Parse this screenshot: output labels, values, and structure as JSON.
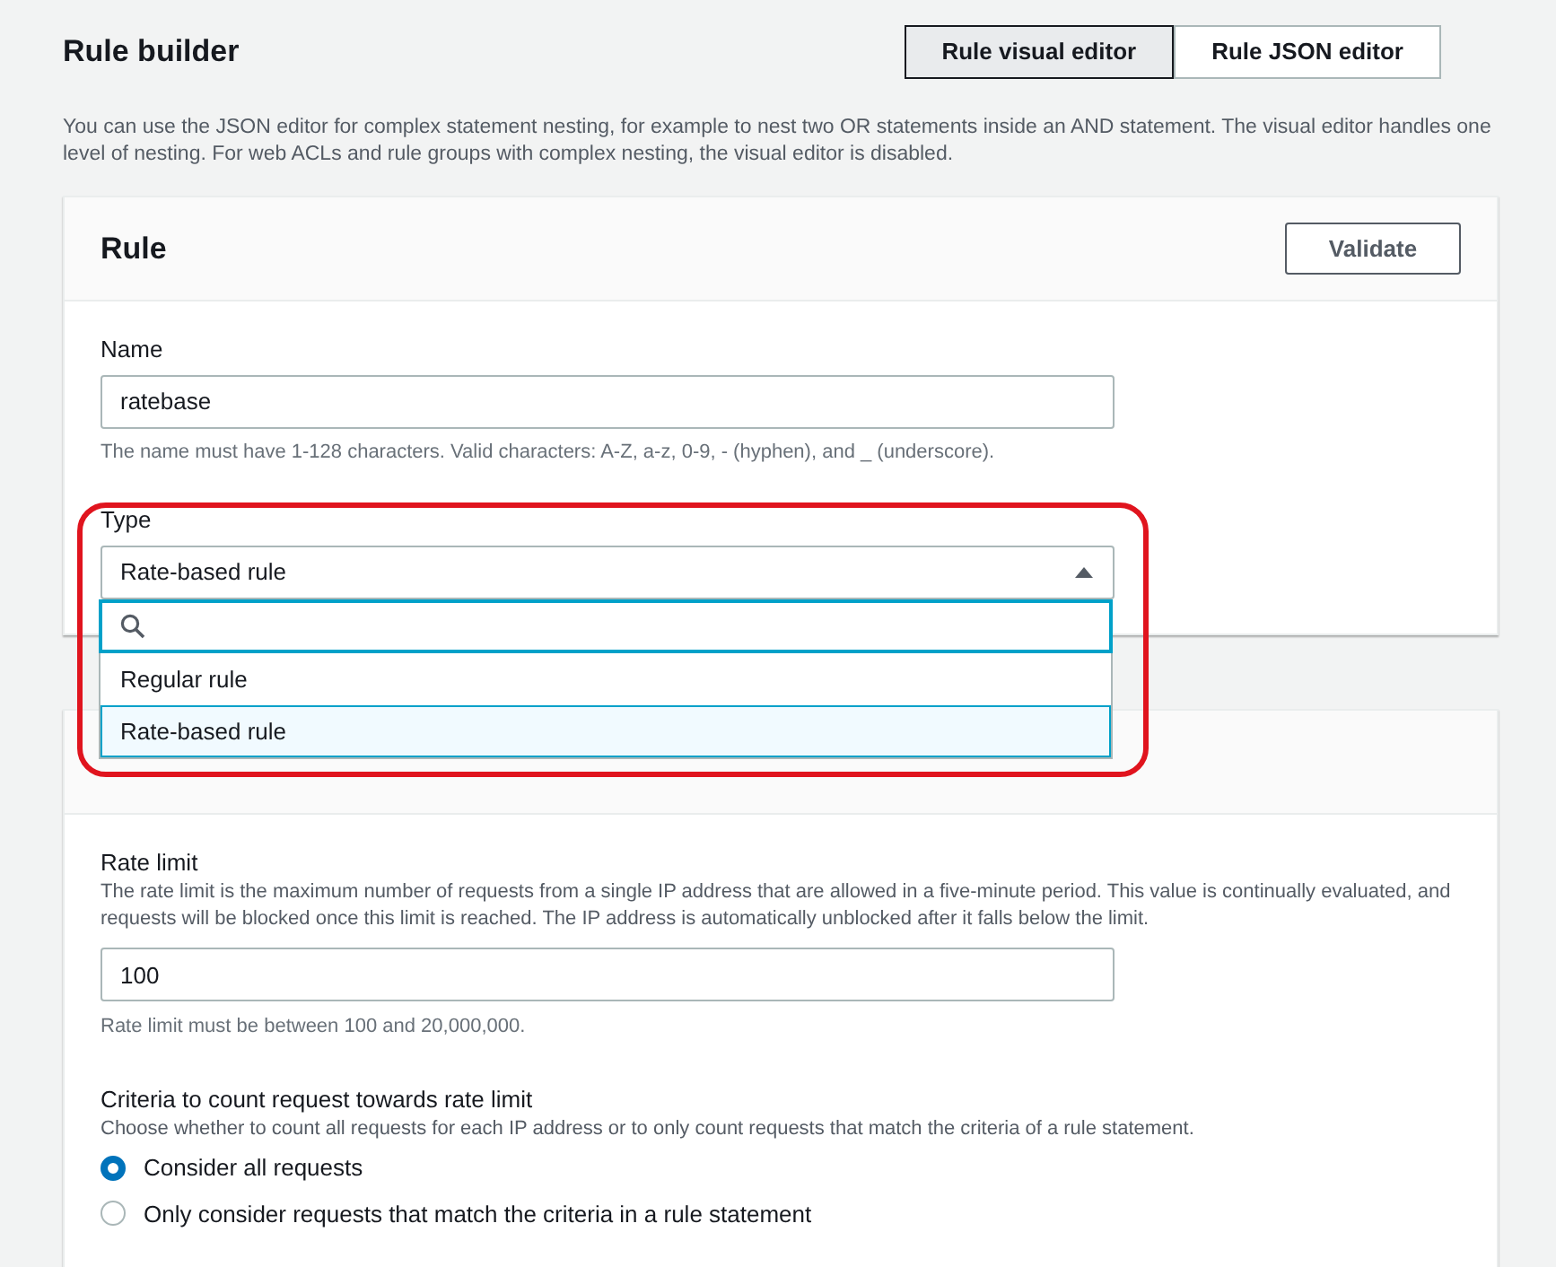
{
  "header": {
    "title": "Rule builder",
    "editor_tabs": [
      {
        "label": "Rule visual editor",
        "selected": true
      },
      {
        "label": "Rule JSON editor",
        "selected": false
      }
    ],
    "description": "You can use the JSON editor for complex statement nesting, for example to nest two OR statements inside an AND statement. The visual editor handles one level of nesting. For web ACLs and rule groups with complex nesting, the visual editor is disabled."
  },
  "rule_card": {
    "title": "Rule",
    "validate_button": "Validate",
    "name_field": {
      "label": "Name",
      "value": "ratebase",
      "hint": "The name must have 1-128 characters. Valid characters: A-Z, a-z, 0-9, - (hyphen), and _ (underscore)."
    },
    "type_select": {
      "label": "Type",
      "value": "Rate-based rule",
      "expanded": true,
      "options": [
        {
          "label": "Regular rule",
          "selected": false
        },
        {
          "label": "Rate-based rule",
          "selected": true
        }
      ]
    }
  },
  "rate_card": {
    "rate_limit": {
      "label": "Rate limit",
      "description": "The rate limit is the maximum number of requests from a single IP address that are allowed in a five-minute period. This value is continually evaluated, and requests will be blocked once this limit is reached. The IP address is automatically unblocked after it falls below the limit.",
      "value": "100",
      "hint": "Rate limit must be between 100 and 20,000,000."
    },
    "criteria": {
      "label": "Criteria to count request towards rate limit",
      "description": "Choose whether to count all requests for each IP address or to only count requests that match the criteria of a rule statement.",
      "options": [
        {
          "label": "Consider all requests",
          "selected": true
        },
        {
          "label": "Only consider requests that match the criteria in a rule statement",
          "selected": false
        }
      ]
    }
  }
}
